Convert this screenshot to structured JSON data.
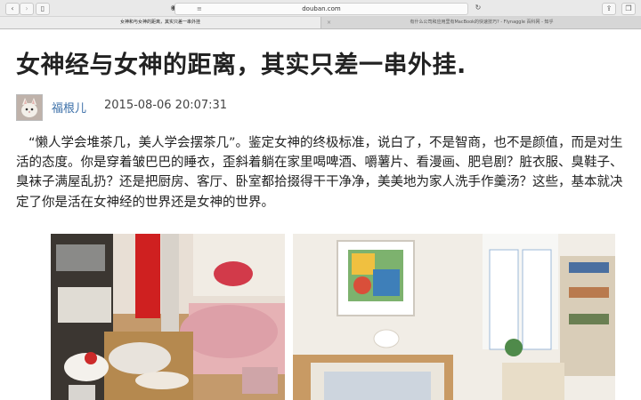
{
  "browser": {
    "url": "douban.com",
    "tabs": [
      {
        "title": "女神和与女神的距离，其实只差一串外挂",
        "active": true
      },
      {
        "title": "有什么公司和应用里有MacBook的快速技巧? - Flynaggle 百科网 - 知乎",
        "active": false
      }
    ]
  },
  "article": {
    "title": "女神经与女神的距离，其实只差一串外挂.",
    "author": "福根儿",
    "date": "2015-08-06 20:07:31",
    "body": "“懒人学会堆茶几，美人学会摆茶几”。鉴定女神的终极标准，说白了，不是智商，也不是颜值，而是对生活的态度。你是穿着皱巴巴的睡衣，歪斜着躺在家里喝啤酒、嚼薯片、看漫画、肥皂剧？脏衣服、臭鞋子、臭袜子满屋乱扔？还是把厨房、客厅、卧室都拾掇得干干净净，美美地为家人洗手作羹汤？这些，基本就决定了你是活在女神经的世界还是女神的世界。"
  },
  "colors": {
    "author_link": "#3b6fa8",
    "title_text": "#222222"
  }
}
